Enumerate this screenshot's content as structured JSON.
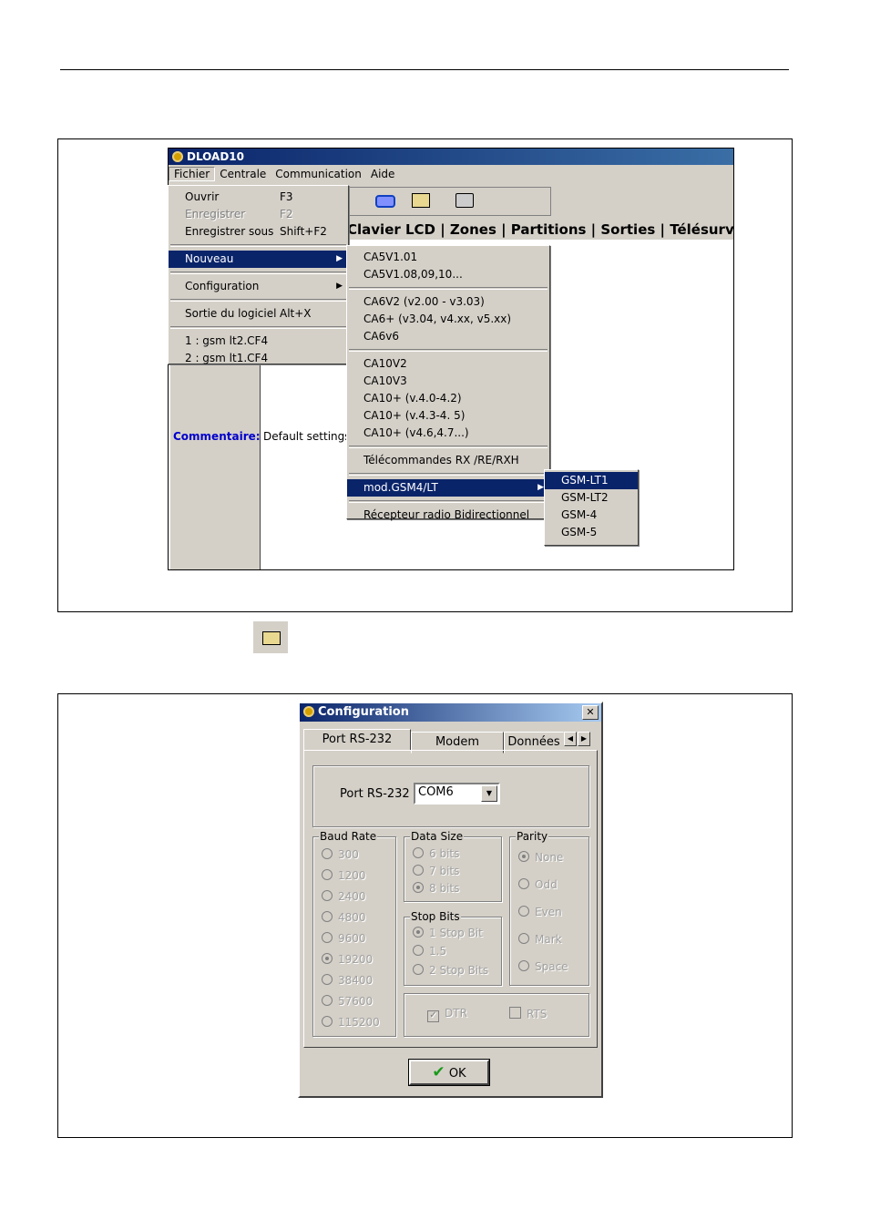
{
  "fig1": {
    "app_title": "DLOAD10",
    "menubar": [
      "Fichier",
      "Centrale",
      "Communication",
      "Aide"
    ],
    "tabs_visible": "Clavier LCD | Zones | Partitions | Sorties | Télésurv",
    "file_menu": {
      "ouvrir": {
        "label": "Ouvrir",
        "shortcut": "F3"
      },
      "enregistrer": {
        "label": "Enregistrer",
        "shortcut": "F2"
      },
      "enregistrer_sous": {
        "label": "Enregistrer sous",
        "shortcut": "Shift+F2"
      },
      "nouveau": "Nouveau",
      "configuration": "Configuration",
      "sortie": {
        "label": "Sortie du logiciel",
        "shortcut": "Alt+X"
      },
      "recent1": "1 : gsm lt2.CF4",
      "recent2": "2 : gsm lt1.CF4"
    },
    "nouveau_submenu": {
      "g1": [
        "CA5V1.01",
        "CA5V1.08,09,10..."
      ],
      "g2": [
        "CA6V2 (v2.00 - v3.03)",
        "CA6+ (v3.04, v4.xx, v5.xx)",
        "CA6v6"
      ],
      "g3": [
        "CA10V2",
        "CA10V3",
        "CA10+ (v.4.0-4.2)",
        "CA10+ (v.4.3-4. 5)",
        "CA10+ (v4.6,4.7...)"
      ],
      "telecommandes": "Télécommandes RX /RE/RXH",
      "mod_gsm": "mod.GSM4/LT",
      "recepteur": "Récepteur radio Bidirectionnel"
    },
    "gsm_submenu": [
      "GSM-LT1",
      "GSM-LT2",
      "GSM-4",
      "GSM-5"
    ],
    "comment_label": "Commentaire:",
    "comment_value": "Default settings."
  },
  "fig2": {
    "title": "Configuration",
    "tabs": [
      "Port RS-232",
      "Modem",
      "Données"
    ],
    "port_label": "Port RS-232",
    "port_value": "COM6",
    "baud_rate": {
      "label": "Baud Rate",
      "options": [
        "300",
        "1200",
        "2400",
        "4800",
        "9600",
        "19200",
        "38400",
        "57600",
        "115200"
      ],
      "selected": "19200"
    },
    "data_size": {
      "label": "Data Size",
      "options": [
        "6 bits",
        "7 bits",
        "8 bits"
      ],
      "selected": "8 bits"
    },
    "stop_bits": {
      "label": "Stop Bits",
      "options": [
        "1 Stop Bit",
        "1.5",
        "2 Stop Bits"
      ],
      "selected": "1 Stop Bit"
    },
    "parity": {
      "label": "Parity",
      "options": [
        "None",
        "Odd",
        "Even",
        "Mark",
        "Space"
      ],
      "selected": "None"
    },
    "dtr": {
      "label": "DTR",
      "checked": true
    },
    "rts": {
      "label": "RTS",
      "checked": false
    },
    "ok": "OK"
  },
  "icons": [
    "app-icon",
    "folder-icon",
    "save-icon",
    "modem-icon",
    "plug-icon",
    "printer-icon",
    "checkmark-icon"
  ]
}
